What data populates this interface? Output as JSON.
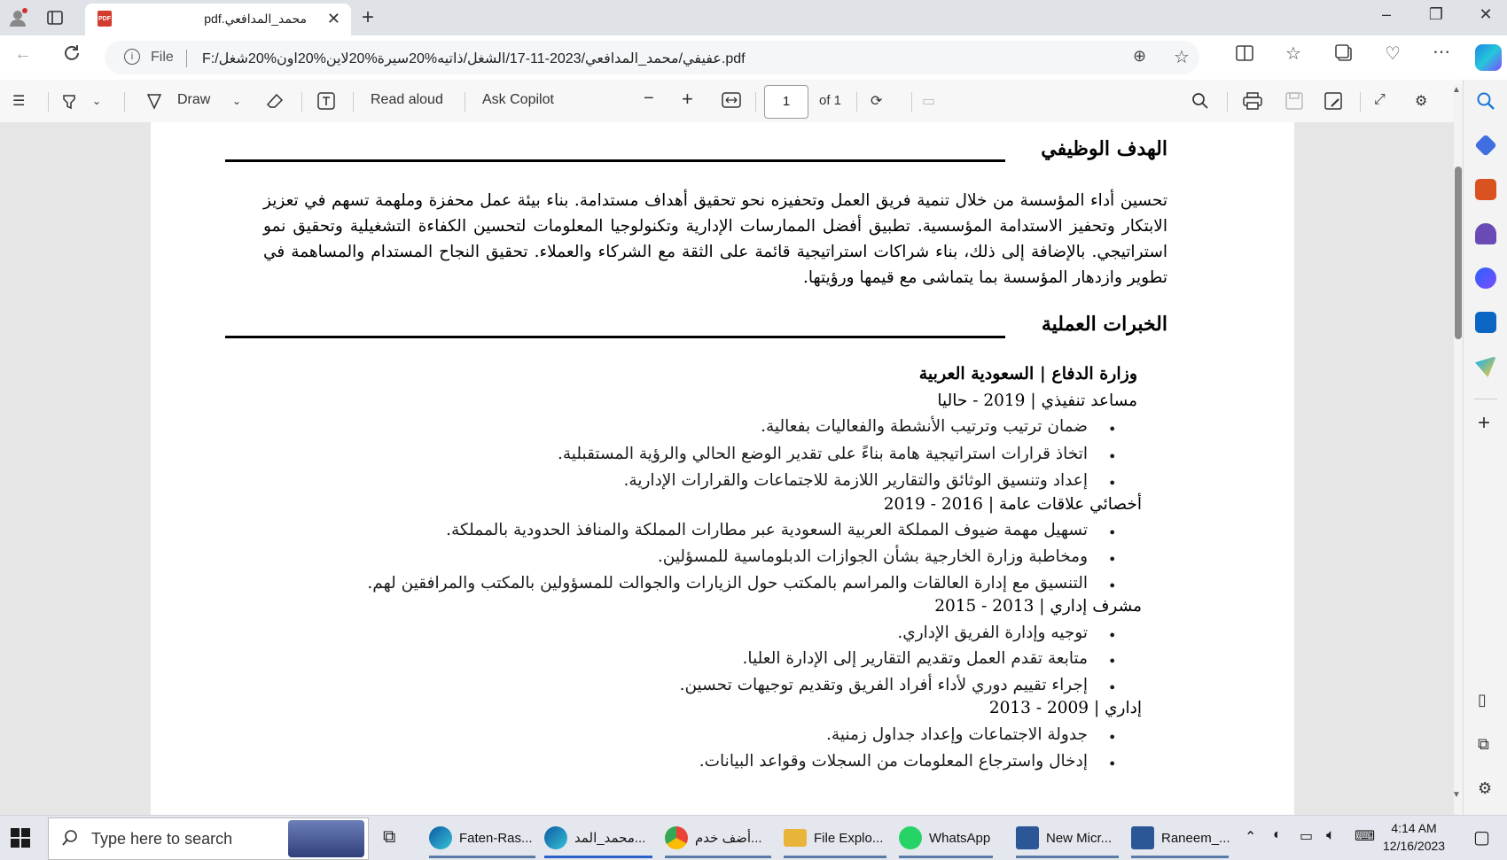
{
  "browser": {
    "tab_title": "محمد_المدافعي.pdf",
    "tab_close": "✕",
    "new_tab": "+",
    "url_label": "File",
    "url": "F:/عفيفي/محمد_المدافعي/2023-11-17/الشغل/ذاتيه%20سيرة%20لاين%20اون%20شغل.pdf",
    "window_controls": [
      "–",
      "❐",
      "✕"
    ]
  },
  "pdf_toolbar": {
    "draw_label": "Draw",
    "read_aloud_label": "Read aloud",
    "ask_copilot_label": "Ask Copilot",
    "page_number": "1",
    "page_count": "of 1"
  },
  "resume": {
    "objective_heading": "الهدف الوظيفي",
    "objective_text": "تحسين أداء المؤسسة من خلال تنمية فريق العمل وتحفيزه نحو تحقيق أهداف مستدامة. بناء بيئة عمل محفزة وملهمة تسهم في تعزيز الابتكار وتحفيز الاستدامة المؤسسية. تطبيق أفضل الممارسات الإدارية وتكنولوجيا المعلومات لتحسين الكفاءة التشغيلية وتحقيق نمو استراتيجي. بالإضافة إلى ذلك، بناء شراكات استراتيجية قائمة على الثقة مع الشركاء والعملاء. تحقيق النجاح المستدام والمساهمة في تطوير وازدهار المؤسسة بما يتماشى مع قيمها ورؤيتها.",
    "experience_heading": "الخبرات العملية",
    "employer": "وزارة الدفاع | السعودية العربية",
    "roles": [
      {
        "title": "مساعد تنفيذي | 2019 - حاليا",
        "bullets": [
          "ضمان ترتيب وترتيب الأنشطة والفعاليات بفعالية.",
          "اتخاذ قرارات استراتيجية هامة بناءً على تقدير الوضع الحالي والرؤية المستقبلية.",
          "إعداد وتنسيق الوثائق والتقارير اللازمة للاجتماعات والقرارات الإدارية."
        ]
      },
      {
        "title": "أخصائي علاقات عامة | 2016 - 2019",
        "bullets": [
          "تسهيل مهمة ضيوف المملكة العربية السعودية عبر مطارات المملكة والمنافذ الحدودية بالمملكة.",
          "ومخاطبة وزارة الخارجية بشأن الجوازات الدبلوماسية للمسؤلين.",
          "التنسيق مع إدارة العالقات والمراسم بالمكتب حول الزيارات والجوالت للمسؤولين بالمكتب والمرافقين لهم."
        ]
      },
      {
        "title": "مشرف إداري | 2013 - 2015",
        "bullets": [
          "توجيه وإدارة الفريق الإداري.",
          "متابعة تقدم العمل وتقديم التقارير إلى الإدارة العليا.",
          "إجراء تقييم دوري لأداء أفراد الفريق وتقديم توجيهات تحسين."
        ]
      },
      {
        "title": "إداري | 2009 - 2013",
        "bullets": [
          "جدولة الاجتماعات وإعداد جداول زمنية.",
          "إدخال واسترجاع المعلومات من السجلات وقواعد البيانات."
        ]
      }
    ]
  },
  "taskbar": {
    "search_placeholder": "Type here to search",
    "apps": [
      {
        "label": "Faten-Ras...",
        "color": "#1a7fd6"
      },
      {
        "label": "محمد_المد...",
        "color": "#1a7fd6"
      },
      {
        "label": "أضف خدم...",
        "color": "#e0452b"
      },
      {
        "label": "File Explo...",
        "color": "#e8b43a"
      },
      {
        "label": "WhatsApp",
        "color": "#25d366"
      },
      {
        "label": "New Micr...",
        "color": "#2b5797"
      },
      {
        "label": "Raneem_...",
        "color": "#2b5797"
      }
    ],
    "time": "4:14 AM",
    "date": "12/16/2023"
  },
  "icons": {
    "tab_actions": "tab-actions-icon",
    "reading_list": "list-icon",
    "highlighter": "highlighter-icon",
    "eraser": "eraser-icon",
    "text_box": "text-icon",
    "search": "search-icon",
    "settings": "gear-icon"
  }
}
